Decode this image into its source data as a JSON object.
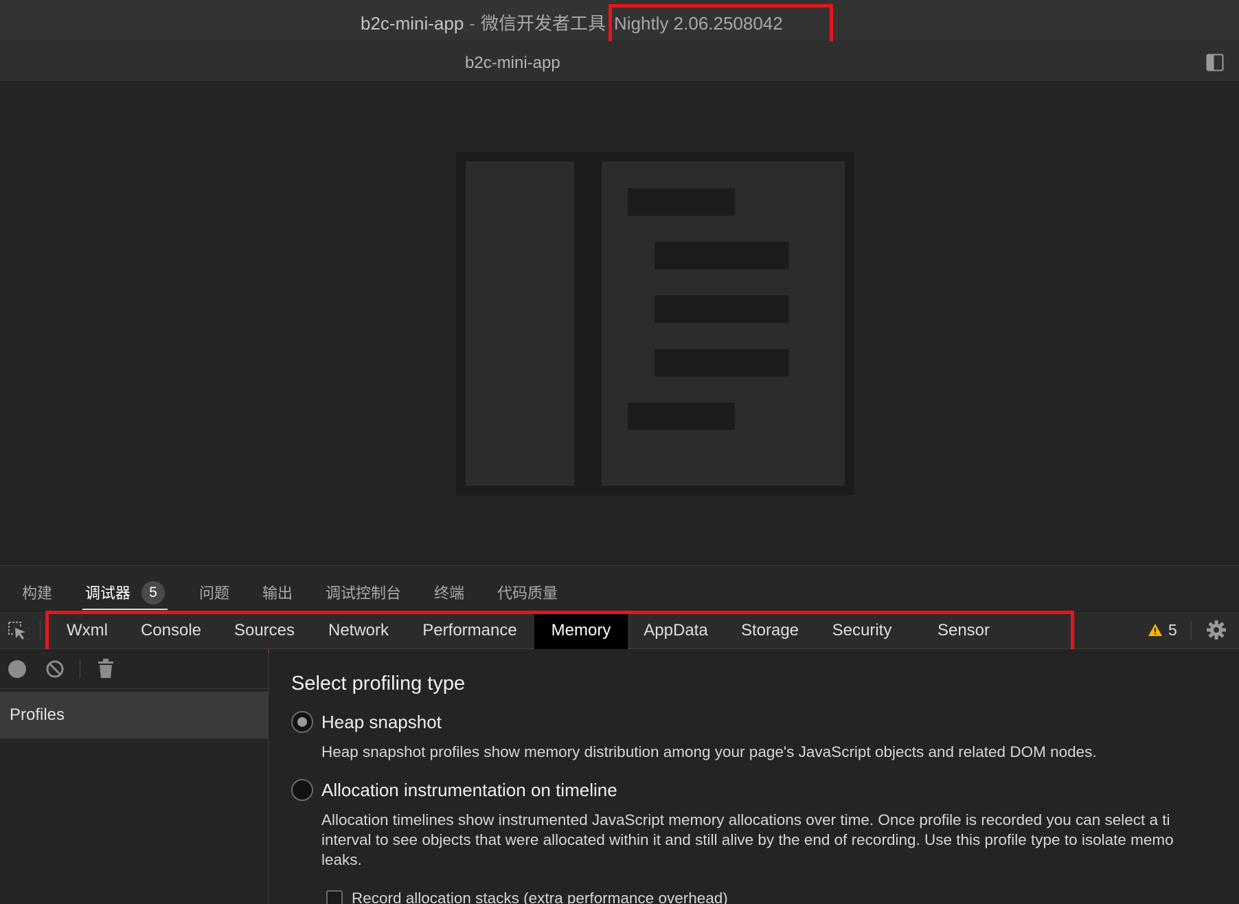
{
  "window": {
    "app_name": "b2c-mini-app",
    "separator": "-",
    "product": "微信开发者工具",
    "version": "Nightly 2.06.2508042"
  },
  "simulator": {
    "tab_title": "b2c-mini-app",
    "toggle_icon": "sidebar-toggle-icon"
  },
  "bottom_tabs": [
    {
      "label": "构建"
    },
    {
      "label": "调试器",
      "badge": "5"
    },
    {
      "label": "问题"
    },
    {
      "label": "输出"
    },
    {
      "label": "调试控制台"
    },
    {
      "label": "终端"
    },
    {
      "label": "代码质量"
    }
  ],
  "active_bottom_tab": "调试器",
  "panel_tabs": [
    {
      "label": "Wxml"
    },
    {
      "label": "Console"
    },
    {
      "label": "Sources"
    },
    {
      "label": "Network"
    },
    {
      "label": "Performance"
    },
    {
      "label": "Memory"
    },
    {
      "label": "AppData"
    },
    {
      "label": "Storage"
    },
    {
      "label": "Security"
    },
    {
      "label": "Sensor"
    }
  ],
  "active_panel_tab": "Memory",
  "warnings": {
    "icon": "warning-triangle-icon",
    "count": "5"
  },
  "colors": {
    "annotation": "#e8141c",
    "active_tab_bg": "#000000",
    "warning": "#f4b400"
  },
  "memory": {
    "sidebar": {
      "profiles_label": "Profiles"
    },
    "heading": "Select profiling type",
    "options": [
      {
        "label": "Heap snapshot",
        "checked": true,
        "description_lines": [
          "Heap snapshot profiles show memory distribution among your page's JavaScript objects and related DOM nodes."
        ]
      },
      {
        "label": "Allocation instrumentation on timeline",
        "checked": false,
        "description_lines": [
          "Allocation timelines show instrumented JavaScript memory allocations over time. Once profile is recorded you can select a ti",
          "interval to see objects that were allocated within it and still alive by the end of recording. Use this profile type to isolate memo",
          "leaks."
        ]
      }
    ],
    "record_stacks_label": "Record allocation stacks (extra performance overhead)"
  }
}
